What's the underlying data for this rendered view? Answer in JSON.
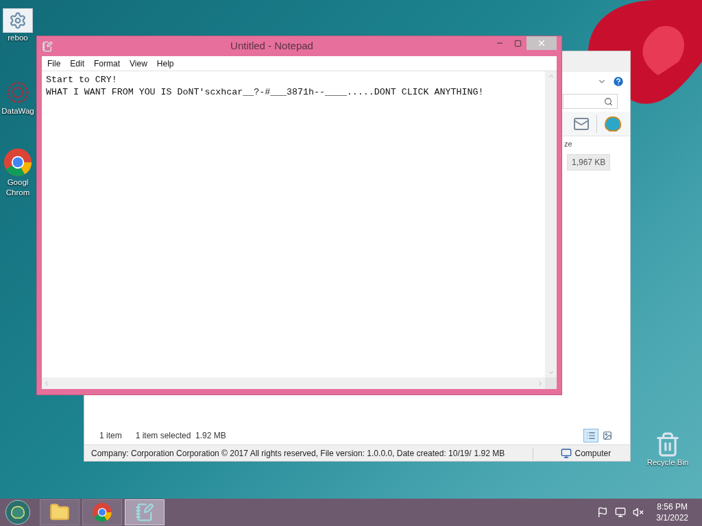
{
  "desktop_icons": [
    {
      "kind": "gears",
      "lines": [
        "reboo"
      ]
    },
    {
      "kind": "network",
      "lines": [
        "DataWag"
      ]
    },
    {
      "kind": "chrome",
      "lines": [
        "Googl",
        "Chrom"
      ]
    },
    {
      "kind": "bin",
      "lines": [
        "Recycle Bin"
      ]
    }
  ],
  "explorer": {
    "column_header": "ze",
    "size_cell": "1,967 KB",
    "item_count": "1 item",
    "selection": "1 item selected  1.92 MB",
    "views": [
      {
        "kind": "details",
        "selected": true
      },
      {
        "kind": "preview",
        "selected": false
      }
    ],
    "status_bar": {
      "details": "Company: Corporation Corporation © 2017 All rights reserved, File version: 1.0.0.0, Date created: 10/19/",
      "size": "1.92 MB",
      "location": "Computer"
    }
  },
  "notepad": {
    "title": "Untitled - Notepad",
    "menu": [
      "File",
      "Edit",
      "Format",
      "View",
      "Help"
    ],
    "lines": [
      "Start to CRY!",
      "WHAT I WANT FROM YOU IS DoNT'scxhcar__?-#___3871h--____.....DONT CLICK ANYTHING!"
    ]
  },
  "taskbar": {
    "items": [
      {
        "kind": "explorer",
        "selected": false
      },
      {
        "kind": "chrome",
        "selected": false
      },
      {
        "kind": "notepad",
        "selected": true
      }
    ],
    "time": "8:56 PM",
    "date": "3/1/2022"
  }
}
